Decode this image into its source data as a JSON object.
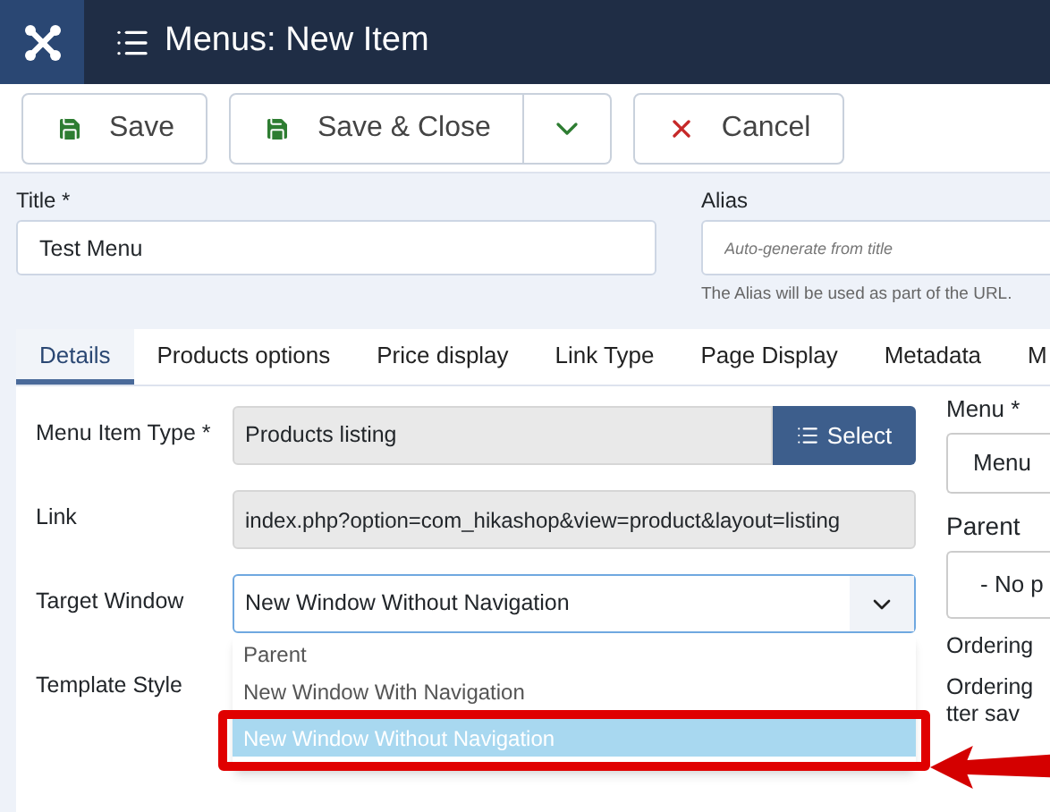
{
  "header": {
    "title": "Menus: New Item"
  },
  "toolbar": {
    "buttons": [
      {
        "label": "Save",
        "kind": "save"
      },
      {
        "label": "Save & Close",
        "kind": "save-close"
      },
      {
        "label": "Cancel",
        "kind": "cancel"
      }
    ]
  },
  "title_field": {
    "label": "Title *",
    "value": "Test Menu"
  },
  "alias_field": {
    "label": "Alias",
    "placeholder": "Auto-generate from title",
    "hint": "The Alias will be used as part of the URL."
  },
  "tabs": [
    {
      "label": "Details",
      "selected": true
    },
    {
      "label": "Products options",
      "selected": false
    },
    {
      "label": "Price display",
      "selected": false
    },
    {
      "label": "Link Type",
      "selected": false
    },
    {
      "label": "Page Display",
      "selected": false
    },
    {
      "label": "Metadata",
      "selected": false
    },
    {
      "label": "M",
      "selected": false
    }
  ],
  "fields": [
    {
      "kind": "type",
      "label": "Menu Item Type *",
      "value": "Products listing",
      "button": "Select"
    },
    {
      "kind": "text",
      "label": "Link",
      "value": "index.php?option=com_hikashop&view=product&layout=listing"
    },
    {
      "kind": "select",
      "label": "Target Window",
      "value": "New Window Without Navigation",
      "options": [
        {
          "label": "Parent",
          "selected": false
        },
        {
          "label": "New Window With Navigation",
          "selected": false
        },
        {
          "label": "New Window Without Navigation",
          "selected": true
        }
      ]
    },
    {
      "kind": "label",
      "label": "Template Style"
    }
  ],
  "side": {
    "menu_label": "Menu *",
    "menu_value": "Menu",
    "parent_label": "Parent",
    "parent_value": "- No p",
    "ordering_label": "Ordering",
    "ordering_hint": [
      "Ordering",
      "tter sav"
    ]
  }
}
